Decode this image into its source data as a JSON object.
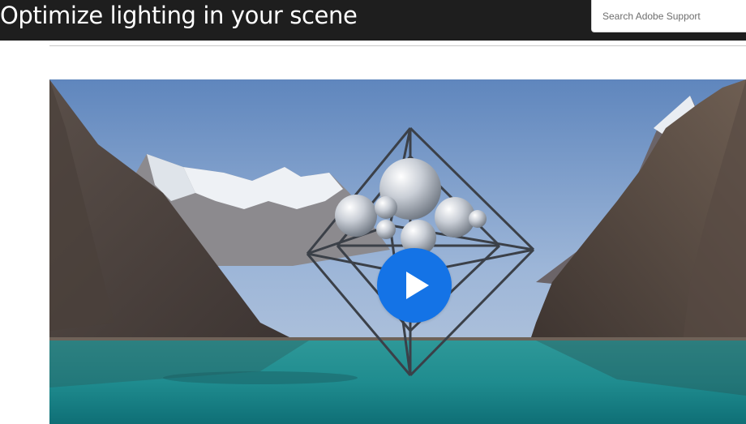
{
  "page": {
    "title": "Optimize lighting in your scene"
  },
  "search": {
    "placeholder": "Search Adobe Support",
    "value": ""
  },
  "video": {
    "play_icon": "play-icon",
    "accent_color": "#1473e6"
  },
  "colors": {
    "header_bg": "#1e1e1e",
    "divider": "#c8c8c8"
  }
}
